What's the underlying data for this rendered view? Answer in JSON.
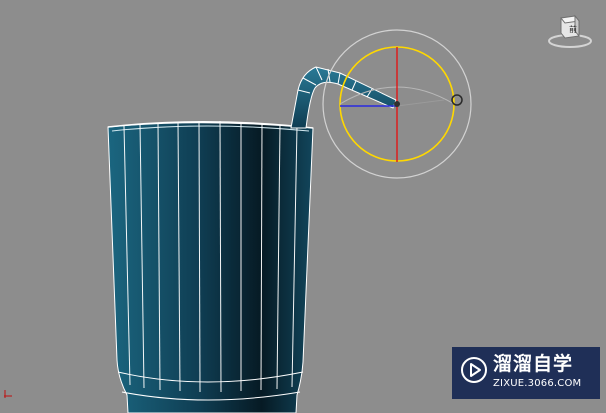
{
  "viewport": {
    "background": "#8d8d8d",
    "view_cube": {
      "icon": "viewcube-icon",
      "label": "前"
    },
    "model": {
      "name": "cup-with-straw",
      "body_color": "#17536c",
      "wire_color": "#ffffff"
    },
    "gizmo": {
      "type": "rotate-gizmo",
      "ring_color": "#ffd800",
      "axis_x_color": "#2a2ae0",
      "axis_y_color": "#e01818"
    }
  },
  "watermark": {
    "brand": "溜溜自学",
    "url": "ZIXUE.3066.COM",
    "background": "#1f2f57",
    "icon": "play-logo-icon"
  }
}
